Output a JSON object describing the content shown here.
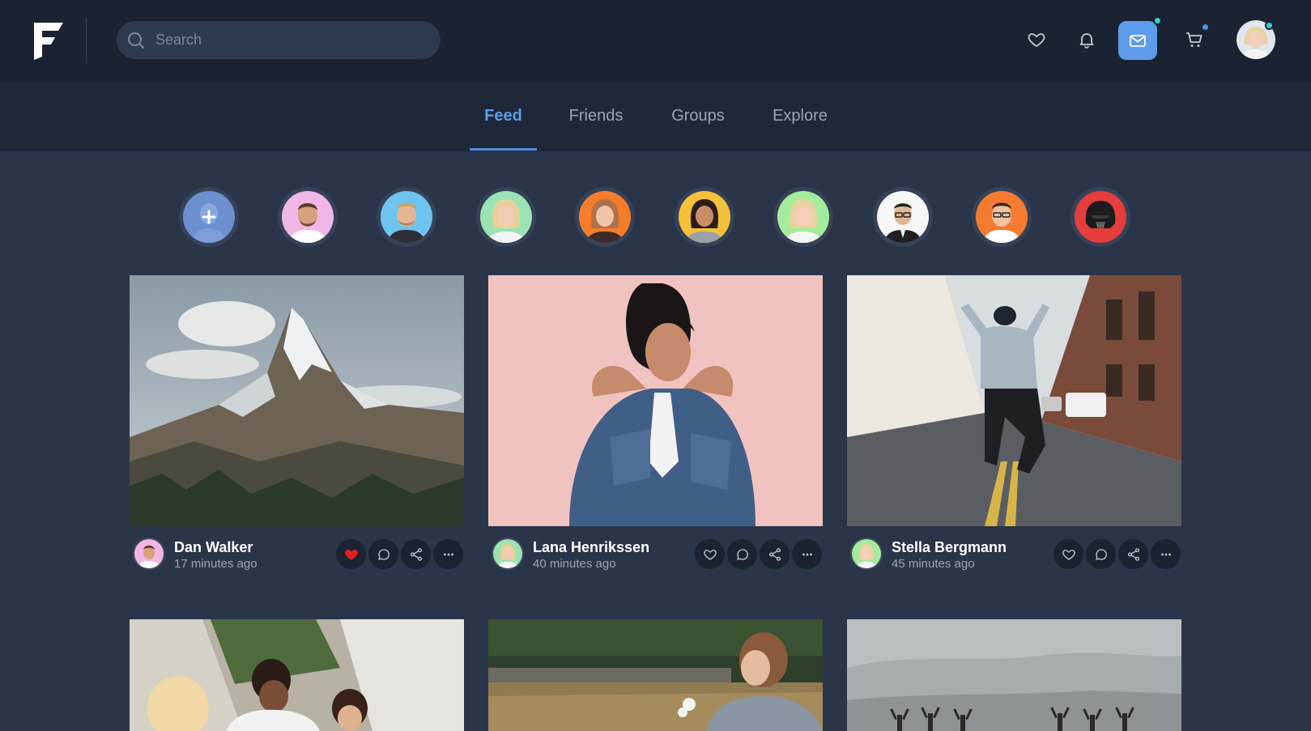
{
  "header": {
    "logo_letter": "F",
    "search": {
      "placeholder": "Search",
      "value": ""
    },
    "icons": [
      "heart-icon",
      "bell-icon",
      "mail-icon",
      "cart-icon",
      "user-avatar"
    ],
    "accent_color": "#5d9cec"
  },
  "tabs": [
    {
      "label": "Feed",
      "active": true
    },
    {
      "label": "Friends",
      "active": false
    },
    {
      "label": "Groups",
      "active": false
    },
    {
      "label": "Explore",
      "active": false
    }
  ],
  "stories": [
    "add-story",
    "man-beard",
    "man-blond",
    "woman-blonde",
    "woman-auburn",
    "woman-dark",
    "woman-blonde-2",
    "man-suit",
    "man-glasses",
    "vader-mask"
  ],
  "posts": [
    {
      "author": "Dan Walker",
      "time": "17 minutes ago",
      "liked": true,
      "image": "mountain-landscape"
    },
    {
      "author": "Lana Henrikssen",
      "time": "40 minutes ago",
      "liked": false,
      "image": "woman-denim-jacket"
    },
    {
      "author": "Stella Bergmann",
      "time": "45 minutes ago",
      "liked": false,
      "image": "man-jumping-street"
    },
    {
      "author": "",
      "time": "",
      "liked": false,
      "image": "friends-group"
    },
    {
      "author": "",
      "time": "",
      "liked": false,
      "image": "woman-field"
    },
    {
      "author": "",
      "time": "",
      "liked": false,
      "image": "people-misty-hills"
    }
  ],
  "colors": {
    "like_active": "#e02020",
    "online_dot": "#2fd3c0",
    "cart_dot": "#4f8fe0"
  }
}
